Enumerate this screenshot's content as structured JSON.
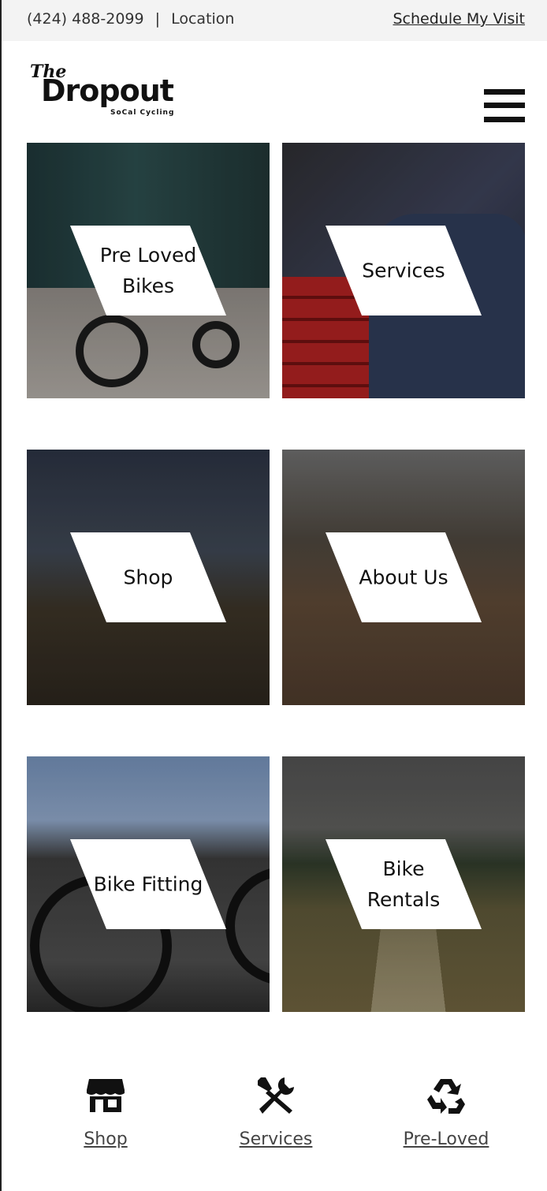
{
  "topbar": {
    "phone": "(424) 488-2099",
    "separator": "|",
    "location": "Location",
    "schedule_link": "Schedule My Visit"
  },
  "logo": {
    "the": "The",
    "name": "Dropout",
    "tagline": "SoCal Cycling"
  },
  "menu": {
    "icon": "hamburger-menu-icon"
  },
  "tiles": [
    {
      "label": "Pre Loved Bikes"
    },
    {
      "label": "Services"
    },
    {
      "label": "Shop"
    },
    {
      "label": "About Us"
    },
    {
      "label": "Bike Fitting"
    },
    {
      "label": "Bike Rentals"
    }
  ],
  "bottom_nav": [
    {
      "icon": "storefront-icon",
      "label": "Shop"
    },
    {
      "icon": "tools-icon",
      "label": "Services"
    },
    {
      "icon": "recycle-icon",
      "label": "Pre-Loved"
    }
  ]
}
